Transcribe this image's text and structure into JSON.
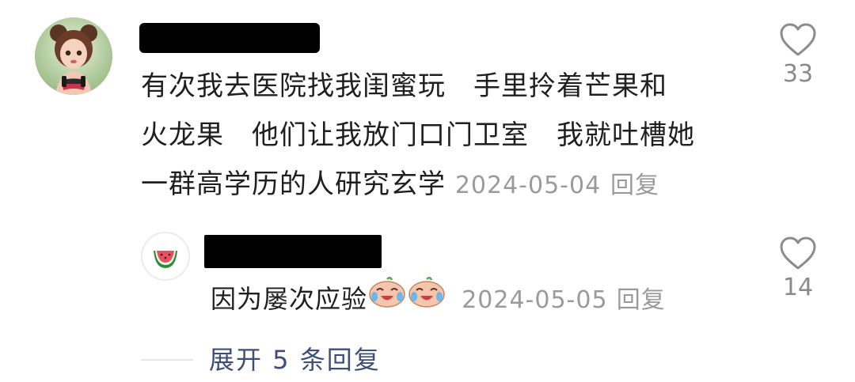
{
  "comment": {
    "text_lines": [
      "有次我去医院找我闺蜜玩　手里拎着芒果和",
      "火龙果　他们让我放门口门卫室　我就吐槽她",
      "一群高学历的人研究玄学"
    ],
    "date": "2024-05-04",
    "reply_label": "回复",
    "like_count": "33",
    "avatar_icon": "girl-avatar-icon"
  },
  "reply": {
    "text": "因为屡次应验",
    "date": "2024-05-05",
    "reply_label": "回复",
    "like_count": "14",
    "avatar_icon": "watermelon-icon",
    "emoji_icon": "crying-laughing-peach-emoji"
  },
  "expand_label": "展开 5 条回复",
  "colors": {
    "meta_gray": "#9a9a9a",
    "link_blue": "#3b4f7a",
    "redaction": "#000000"
  }
}
